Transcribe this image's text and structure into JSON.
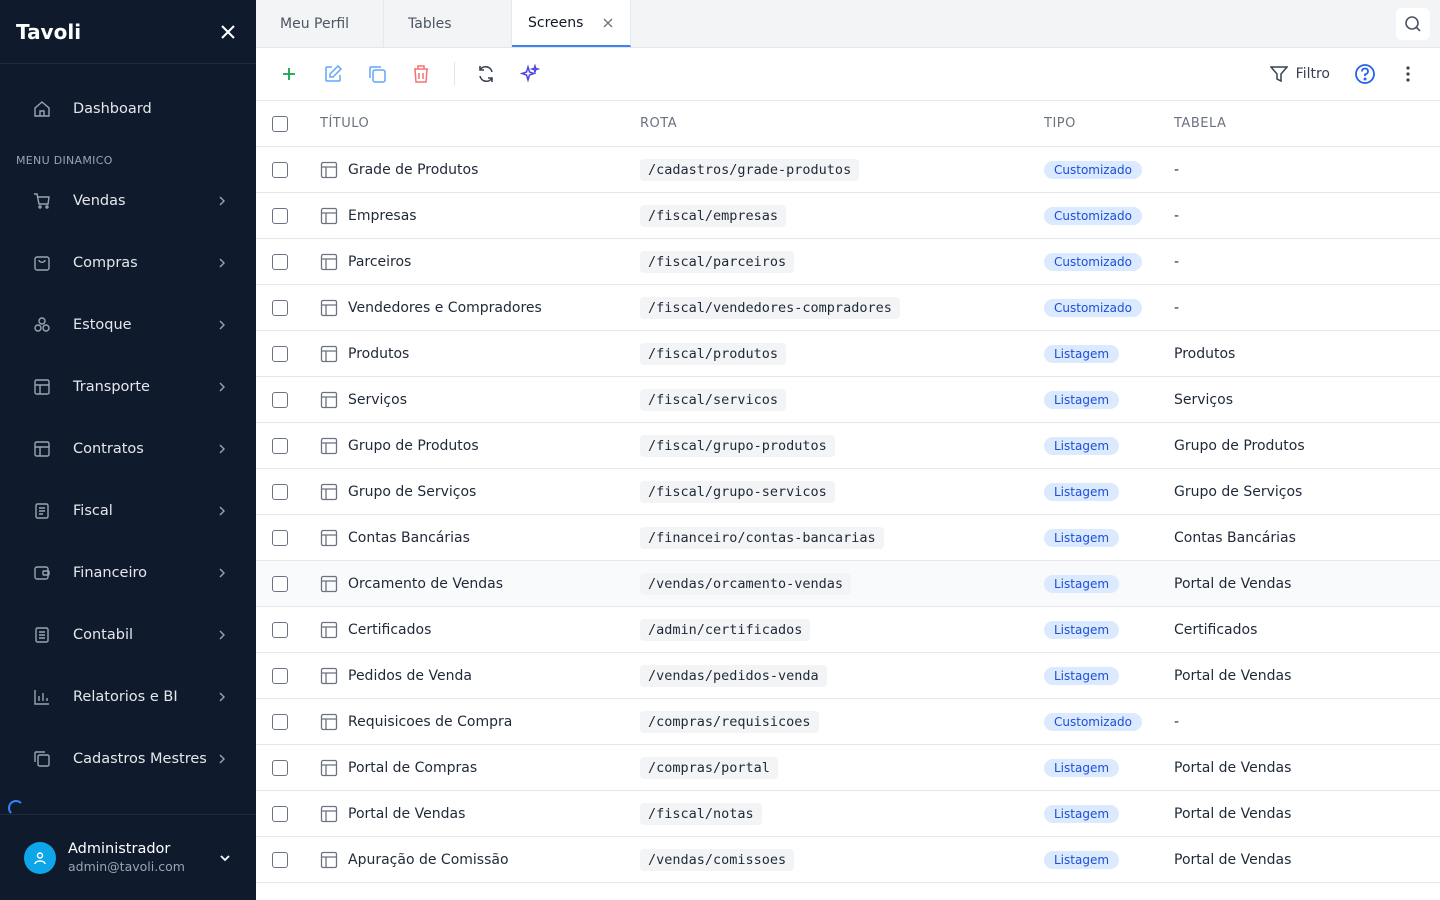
{
  "sidebar": {
    "brand": "Tavoli",
    "dashboard": {
      "label": "Dashboard",
      "icon": "home-icon"
    },
    "section_label": "MENU DINAMICO",
    "items": [
      {
        "label": "Vendas",
        "icon": "cart-icon"
      },
      {
        "label": "Compras",
        "icon": "bag-icon"
      },
      {
        "label": "Estoque",
        "icon": "boxes-icon"
      },
      {
        "label": "Transporte",
        "icon": "table-icon"
      },
      {
        "label": "Contratos",
        "icon": "table-icon"
      },
      {
        "label": "Fiscal",
        "icon": "document-icon"
      },
      {
        "label": "Financeiro",
        "icon": "wallet-icon"
      },
      {
        "label": "Contabil",
        "icon": "ledger-icon"
      },
      {
        "label": "Relatorios e BI",
        "icon": "bar-chart-icon"
      },
      {
        "label": "Cadastros Mestres",
        "icon": "copy-icon"
      }
    ],
    "user": {
      "name": "Administrador",
      "email": "admin@tavoli.com"
    }
  },
  "tabs": [
    {
      "label": "Meu Perfil",
      "active": false
    },
    {
      "label": "Tables",
      "active": false
    },
    {
      "label": "Screens",
      "active": true
    }
  ],
  "toolbar": {
    "filter_label": "Filtro"
  },
  "table": {
    "headers": {
      "titulo": "TÍTULO",
      "rota": "ROTA",
      "tipo": "TIPO",
      "tabela": "TABELA"
    },
    "rows": [
      {
        "titulo": "Grade de Produtos",
        "rota": "/cadastros/grade-produtos",
        "tipo": "Customizado",
        "tabela": "-"
      },
      {
        "titulo": "Empresas",
        "rota": "/fiscal/empresas",
        "tipo": "Customizado",
        "tabela": "-"
      },
      {
        "titulo": "Parceiros",
        "rota": "/fiscal/parceiros",
        "tipo": "Customizado",
        "tabela": "-"
      },
      {
        "titulo": "Vendedores e Compradores",
        "rota": "/fiscal/vendedores-compradores",
        "tipo": "Customizado",
        "tabela": "-"
      },
      {
        "titulo": "Produtos",
        "rota": "/fiscal/produtos",
        "tipo": "Listagem",
        "tabela": "Produtos"
      },
      {
        "titulo": "Serviços",
        "rota": "/fiscal/servicos",
        "tipo": "Listagem",
        "tabela": "Serviços"
      },
      {
        "titulo": "Grupo de Produtos",
        "rota": "/fiscal/grupo-produtos",
        "tipo": "Listagem",
        "tabela": "Grupo de Produtos"
      },
      {
        "titulo": "Grupo de Serviços",
        "rota": "/fiscal/grupo-servicos",
        "tipo": "Listagem",
        "tabela": "Grupo de Serviços"
      },
      {
        "titulo": "Contas Bancárias",
        "rota": "/financeiro/contas-bancarias",
        "tipo": "Listagem",
        "tabela": "Contas Bancárias"
      },
      {
        "titulo": "Orcamento de Vendas",
        "rota": "/vendas/orcamento-vendas",
        "tipo": "Listagem",
        "tabela": "Portal de Vendas"
      },
      {
        "titulo": "Certificados",
        "rota": "/admin/certificados",
        "tipo": "Listagem",
        "tabela": "Certificados"
      },
      {
        "titulo": "Pedidos de Venda",
        "rota": "/vendas/pedidos-venda",
        "tipo": "Listagem",
        "tabela": "Portal de Vendas"
      },
      {
        "titulo": "Requisicoes de Compra",
        "rota": "/compras/requisicoes",
        "tipo": "Customizado",
        "tabela": "-"
      },
      {
        "titulo": "Portal de Compras",
        "rota": "/compras/portal",
        "tipo": "Listagem",
        "tabela": "Portal de Vendas"
      },
      {
        "titulo": "Portal de Vendas",
        "rota": "/fiscal/notas",
        "tipo": "Listagem",
        "tabela": "Portal de Vendas"
      },
      {
        "titulo": "Apuração de Comissão",
        "rota": "/vendas/comissoes",
        "tipo": "Listagem",
        "tabela": "Portal de Vendas"
      }
    ]
  },
  "colors": {
    "sidebar_bg": "#0f1b2d",
    "accent": "#3b82f6",
    "badge_bg": "#dbeafe",
    "badge_text": "#1d4ed8"
  }
}
